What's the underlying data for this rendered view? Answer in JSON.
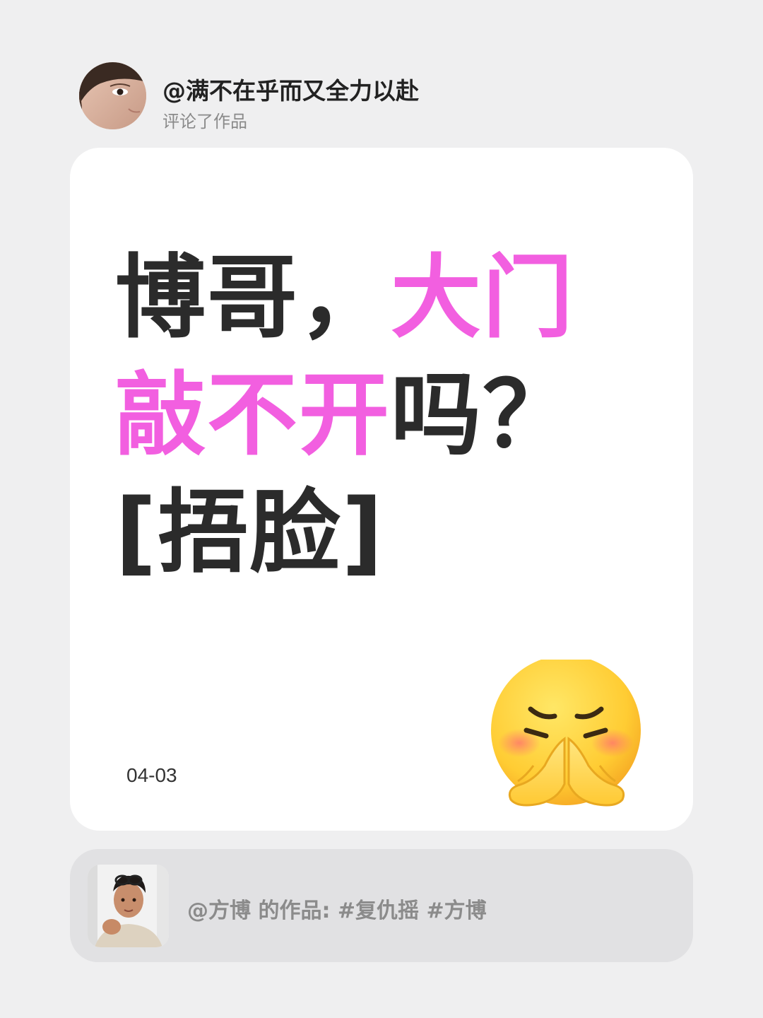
{
  "comment_header": {
    "username": "@满不在乎而又全力以赴",
    "action": "评论了作品"
  },
  "comment_card": {
    "text_parts": [
      "博哥，",
      "大门敲不开",
      "吗？[捂脸]"
    ],
    "date": "04-03",
    "highlight_color": "#f25fe0",
    "text_color": "#2b2b2b",
    "emoji": "face-with-folded-hands-emoji"
  },
  "work_bar": {
    "text": "@方博 的作品: #复仇摇 #方博"
  }
}
